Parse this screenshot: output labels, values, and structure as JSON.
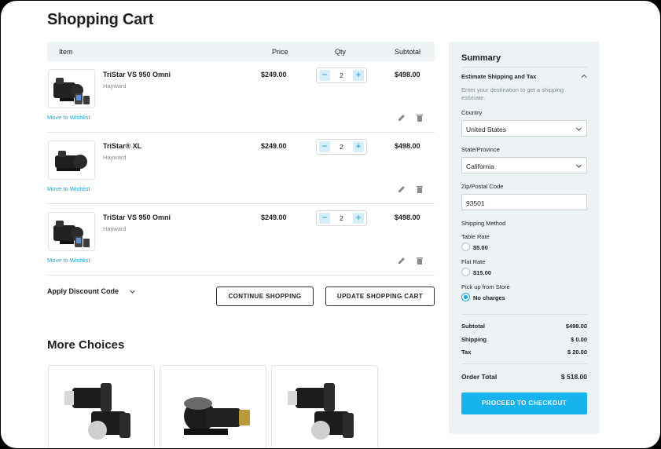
{
  "page": {
    "title": "Shopping Cart"
  },
  "cart": {
    "headers": {
      "item": "Item",
      "price": "Price",
      "qty": "Qty",
      "subtotal": "Subtotal"
    },
    "rows": [
      {
        "name": "TriStar VS 950 Omni",
        "brand": "Hayward",
        "price": "$249.00",
        "qty": "2",
        "subtotal": "$498.00",
        "wishlist": "Move to Wishlist"
      },
      {
        "name": "TriStar® XL",
        "brand": "Hayward",
        "price": "$249.00",
        "qty": "2",
        "subtotal": "$498.00",
        "wishlist": "Move to Wishlist"
      },
      {
        "name": "TriStar VS 950 Omni",
        "brand": "Hayward",
        "price": "$249.00",
        "qty": "2",
        "subtotal": "$498.00",
        "wishlist": "Move to Wishlist"
      }
    ],
    "discount_label": "Apply Discount Code",
    "continue_label": "CONTINUE SHOPPING",
    "update_label": "UPDATE SHOPPING CART"
  },
  "more_choices": {
    "title": "More Choices"
  },
  "summary": {
    "title": "Summary",
    "estimate_title": "Estimate Shipping and Tax",
    "estimate_help": "Enter your destination to get a shipping estimate.",
    "country_label": "Country",
    "country_value": "United States",
    "state_label": "State/Province",
    "state_value": "California",
    "zip_label": "Zip/Postal Code",
    "zip_value": "93501",
    "shipping_method_label": "Shipping Method",
    "methods": [
      {
        "name": "Table Rate",
        "price": "$5.00",
        "selected": false
      },
      {
        "name": "Flat Rate",
        "price": "$15.00",
        "selected": false
      },
      {
        "name": "Pick up from Store",
        "price": "No charges",
        "selected": true
      }
    ],
    "subtotal_label": "Subtotal",
    "subtotal_value": "$498.00",
    "shipping_label": "Shipping",
    "shipping_value": "$ 0.00",
    "tax_label": "Tax",
    "tax_value": "$ 20.00",
    "order_total_label": "Order Total",
    "order_total_value": "$ 518.00",
    "checkout_label": "PROCEED TO CHECKOUT"
  },
  "colors": {
    "accent": "#16b3ee",
    "link": "#16a5e0",
    "panel": "#edf2f5"
  }
}
